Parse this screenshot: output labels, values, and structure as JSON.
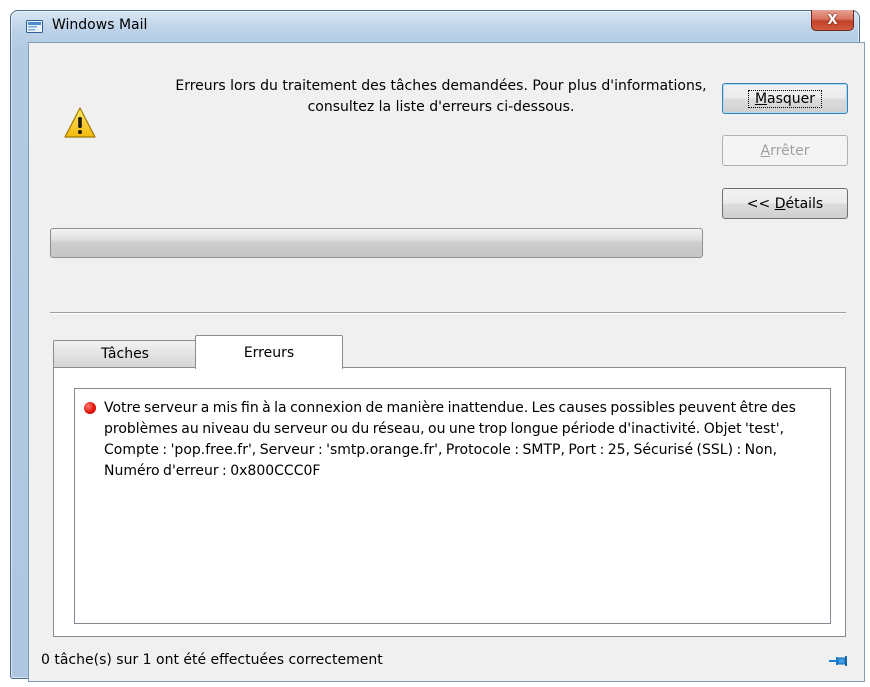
{
  "window": {
    "title": "Windows Mail",
    "close_label": "X"
  },
  "message": "Erreurs lors du traitement des tâches demandées. Pour plus d'informations, consultez la liste d'erreurs ci-dessous.",
  "buttons": {
    "hide": {
      "mnemonic": "M",
      "rest": "asquer"
    },
    "stop": {
      "mnemonic": "A",
      "rest": "rrêter",
      "enabled": false
    },
    "details": {
      "prefix": "<< ",
      "mnemonic": "D",
      "rest": "étails"
    }
  },
  "progress": {
    "value": 0
  },
  "tabs": [
    {
      "label": "Tâches",
      "selected": false
    },
    {
      "label": "Erreurs",
      "selected": true
    }
  ],
  "errors": [
    {
      "icon": "error-red-dot",
      "text": "Votre serveur a mis fin à la connexion de manière inattendue. Les causes possibles peuvent être des problèmes au niveau du serveur ou du réseau, ou une trop longue période d'inactivité. Objet 'test', Compte : 'pop.free.fr', Serveur : 'smtp.orange.fr', Protocole : SMTP, Port : 25, Sécurisé (SSL) : Non, Numéro d'erreur : 0x800CCC0F"
    }
  ],
  "status": "0 tâche(s) sur 1 ont été effectuées correctement",
  "icons": {
    "title": "windows-mail-icon",
    "warning": "warning-icon",
    "pin": "pin-icon"
  },
  "colors": {
    "close_button": "#c2412a",
    "error_dot": "#e3140a",
    "warning_fill": "#f7d21e",
    "pin": "#1a7fd4"
  }
}
